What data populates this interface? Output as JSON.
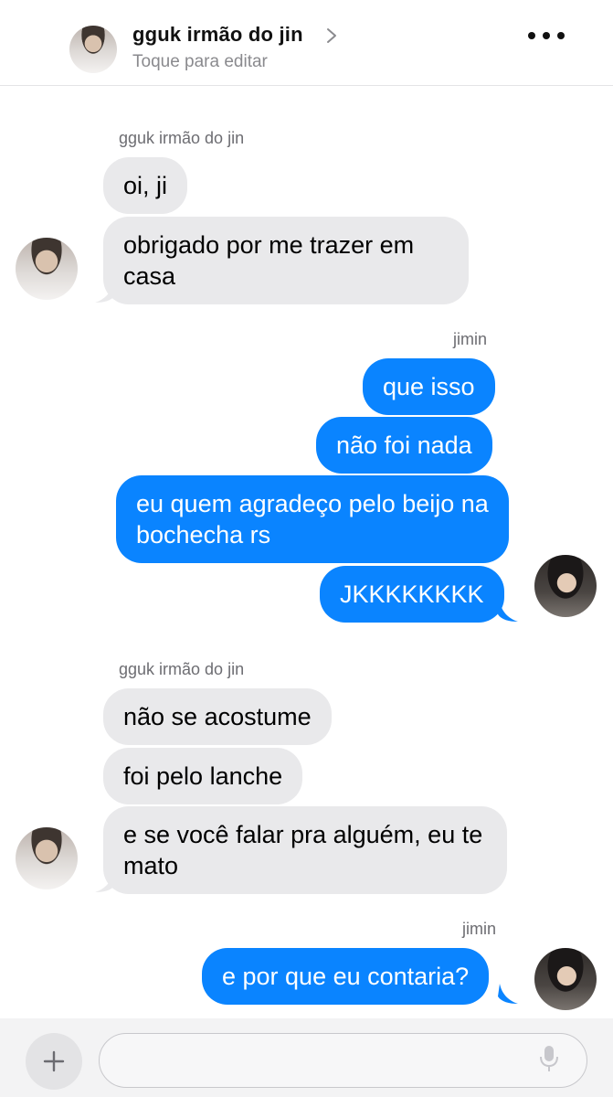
{
  "header": {
    "contact_name": "gguk irmão do jin",
    "subtitle": "Toque para editar"
  },
  "messages": [
    {
      "sender": "gguk irmão do jin",
      "texts": [
        "oi, ji",
        "obrigado por me trazer em casa"
      ]
    },
    {
      "sender": "jimin",
      "texts": [
        "que isso",
        "não foi nada",
        "eu quem agradeço pelo beijo na bochecha rs",
        "JKKKKKKKK"
      ]
    },
    {
      "sender": "gguk irmão do jin",
      "texts": [
        "não se acostume",
        "foi pelo lanche",
        "e se você falar pra alguém, eu te mato"
      ]
    },
    {
      "sender": "jimin",
      "texts": [
        "e por que eu contaria?"
      ]
    }
  ],
  "composer": {
    "value": "",
    "placeholder": ""
  },
  "colors": {
    "outgoing_bubble": "#0a84ff",
    "incoming_bubble": "#e9e9eb"
  },
  "icons": {
    "header_avatar": "avatar-photo",
    "chevron": "chevron-right-icon",
    "more": "ellipsis-icon",
    "add": "plus-icon",
    "mic": "microphone-icon"
  }
}
